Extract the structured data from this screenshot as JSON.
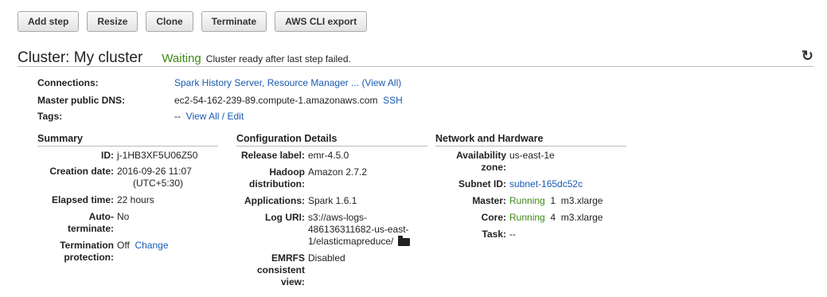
{
  "toolbar": {
    "add_step": "Add step",
    "resize": "Resize",
    "clone": "Clone",
    "terminate": "Terminate",
    "cli_export": "AWS CLI export"
  },
  "header": {
    "title": "Cluster: My cluster",
    "status": "Waiting",
    "status_message": "Cluster ready after last step failed.",
    "refresh_icon": "refresh-icon"
  },
  "info": {
    "connections_label": "Connections:",
    "connections_links": "Spark History Server, Resource Manager ...",
    "connections_viewall": "(View All)",
    "dns_label": "Master public DNS:",
    "dns_value": "ec2-54-162-239-89.compute-1.amazonaws.com",
    "dns_ssh": "SSH",
    "tags_label": "Tags:",
    "tags_value": "--",
    "tags_link": "View All / Edit"
  },
  "summary": {
    "title": "Summary",
    "id_label": "ID:",
    "id_value": "j-1HB3XF5U06Z50",
    "created_label": "Creation date:",
    "created_value_1": "2016-09-26 11:07",
    "created_value_2": "(UTC+5:30)",
    "elapsed_label": "Elapsed time:",
    "elapsed_value": "22 hours",
    "autoterm_label_1": "Auto-",
    "autoterm_label_2": "terminate:",
    "autoterm_value": "No",
    "termprot_label_1": "Termination",
    "termprot_label_2": "protection:",
    "termprot_value": "Off",
    "termprot_change": "Change"
  },
  "config": {
    "title": "Configuration Details",
    "release_label": "Release label:",
    "release_value": "emr-4.5.0",
    "hadoop_label_1": "Hadoop",
    "hadoop_label_2": "distribution:",
    "hadoop_value": "Amazon 2.7.2",
    "apps_label": "Applications:",
    "apps_value": "Spark 1.6.1",
    "log_label": "Log URI:",
    "log_value_1": "s3://aws-logs-",
    "log_value_2": "486136311682-us-east-",
    "log_value_3": "1/elasticmapreduce/",
    "log_icon": "folder-icon",
    "emrfs_label_1": "EMRFS",
    "emrfs_label_2": "consistent",
    "emrfs_label_3": "view:",
    "emrfs_value": "Disabled"
  },
  "network": {
    "title": "Network and Hardware",
    "az_label_1": "Availability",
    "az_label_2": "zone:",
    "az_value": "us-east-1e",
    "subnet_label": "Subnet ID:",
    "subnet_value": "subnet-165dc52c",
    "master_label": "Master:",
    "master_status": "Running",
    "master_count": "1",
    "master_type": "m3.xlarge",
    "core_label": "Core:",
    "core_status": "Running",
    "core_count": "4",
    "core_type": "m3.xlarge",
    "task_label": "Task:",
    "task_value": "--"
  }
}
